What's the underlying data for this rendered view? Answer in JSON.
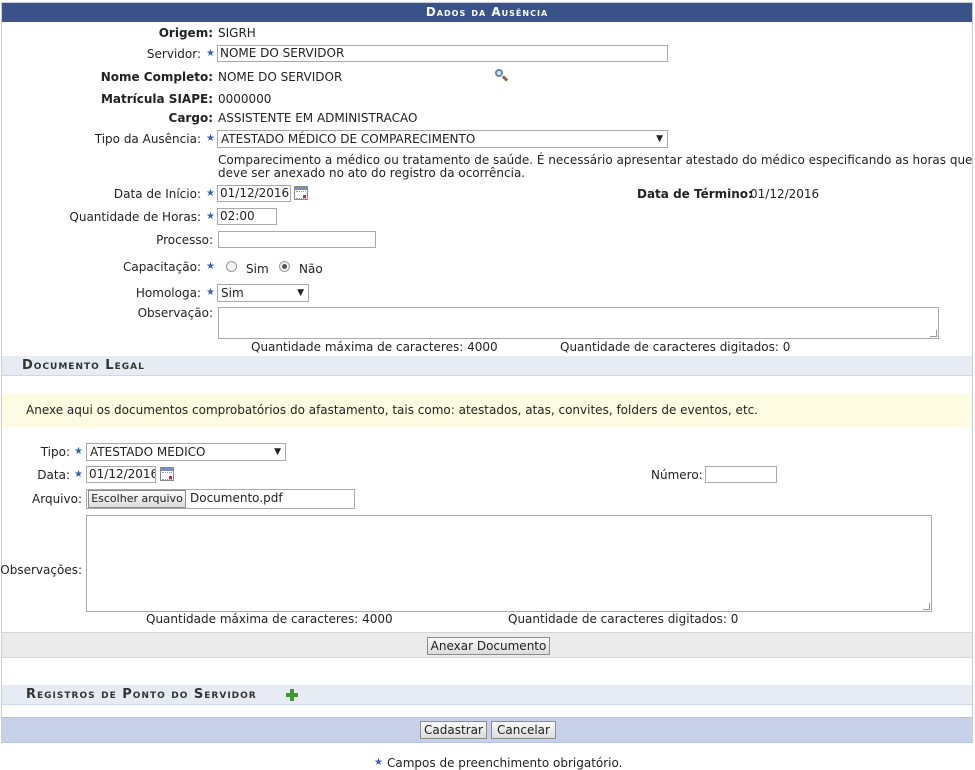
{
  "title": "Dados da Ausência",
  "required_mark": "★",
  "form": {
    "origem": {
      "label": "Origem:",
      "value": "SIGRH"
    },
    "servidor": {
      "label": "Servidor:",
      "value": "NOME DO SERVIDOR"
    },
    "nome_completo": {
      "label": "Nome Completo:",
      "value": "NOME DO SERVIDOR"
    },
    "matricula": {
      "label": "Matrícula SIAPE:",
      "value": "0000000"
    },
    "cargo": {
      "label": "Cargo:",
      "value": "ASSISTENTE EM ADMINISTRACAO"
    },
    "tipo_ausencia": {
      "label": "Tipo da Ausência:",
      "value": "ATESTADO MÉDICO DE COMPARECIMENTO",
      "description_line1": "Comparecimento a médico ou tratamento de saúde. É necessário apresentar atestado do médico especificando as horas que",
      "description_line2": "deve ser anexado no ato do registro da ocorrência."
    },
    "data_inicio": {
      "label": "Data de Início:",
      "value": "01/12/2016"
    },
    "data_termino": {
      "label": "Data de Término:",
      "value": "01/12/2016"
    },
    "quantidade_horas": {
      "label": "Quantidade de Horas:",
      "value": "02:00"
    },
    "processo": {
      "label": "Processo:",
      "value": ""
    },
    "capacitacao": {
      "label": "Capacitação:",
      "options": [
        "Sim",
        "Não"
      ],
      "selected": "Não"
    },
    "homologa": {
      "label": "Homologa:",
      "value": "Sim"
    },
    "observacao": {
      "label": "Observação:",
      "max_chars": "Quantidade máxima de caracteres: 4000",
      "typed_chars": "Quantidade de caracteres digitados: 0"
    }
  },
  "documento_legal": {
    "title": "Documento Legal",
    "notice": "Anexe aqui os documentos comprobatórios do afastamento, tais como: atestados, atas, convites, folders de eventos, etc.",
    "tipo": {
      "label": "Tipo:",
      "value": "ATESTADO MEDICO"
    },
    "data": {
      "label": "Data:",
      "value": "01/12/2016"
    },
    "numero": {
      "label": "Número:",
      "value": ""
    },
    "arquivo": {
      "label": "Arquivo:",
      "button": "Escolher arquivo",
      "filename": "Documento.pdf"
    },
    "observacoes": {
      "label": "Observações:",
      "max_chars": "Quantidade máxima de caracteres: 4000",
      "typed_chars": "Quantidade de caracteres digitados: 0"
    },
    "anexar_button": "Anexar Documento"
  },
  "registros": {
    "title": "Registros de Ponto do Servidor"
  },
  "actions": {
    "cadastrar": "Cadastrar",
    "cancelar": "Cancelar"
  },
  "footer_note": "Campos de preenchimento obrigatório."
}
